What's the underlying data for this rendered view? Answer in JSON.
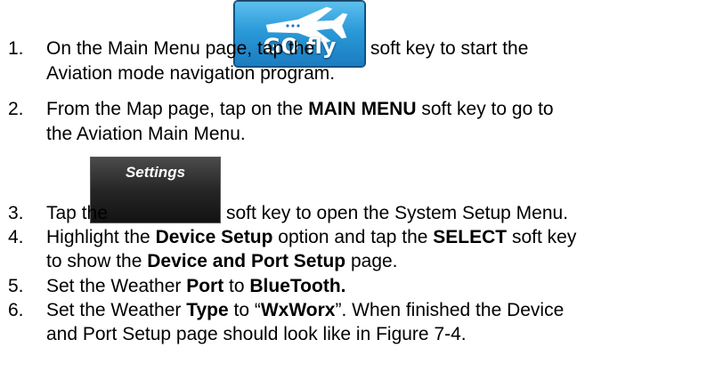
{
  "buttons": {
    "gofly_label": "GO fly",
    "settings_label": "Settings"
  },
  "steps": [
    {
      "num": "1.",
      "lines": [
        {
          "a": "On the Main Menu page, tap the",
          "b": "soft key to start the"
        },
        {
          "a": "Aviation mode navigation program."
        }
      ]
    },
    {
      "num": "2.",
      "lines": [
        {
          "a": "From the Map page, tap on the ",
          "b": "MAIN MENU",
          "c": " soft key to go to"
        },
        {
          "a": "the Aviation Main Menu."
        }
      ]
    },
    {
      "num": "3.",
      "lines": [
        {
          "a": "Tap the",
          "b": "soft key to open the System Setup Menu."
        }
      ]
    },
    {
      "num": "4.",
      "lines": [
        {
          "a": "Highlight the ",
          "b": "Device Setup",
          "c": " option and tap the ",
          "d": "SELECT",
          "e": " soft key"
        },
        {
          "a": "to show the ",
          "b": "Device and Port Setup",
          "c": " page."
        }
      ]
    },
    {
      "num": "5.",
      "lines": [
        {
          "a": "Set the Weather ",
          "b": "Port",
          "c": " to ",
          "d": "BlueTooth."
        }
      ]
    },
    {
      "num": "6.",
      "lines": [
        {
          "a": "Set the Weather ",
          "b": "Type",
          "c": " to “",
          "d": "WxWorx",
          "e": "”. When finished the Device"
        },
        {
          "a": "and Port Setup page should look like in Figure 7-4."
        }
      ]
    }
  ]
}
